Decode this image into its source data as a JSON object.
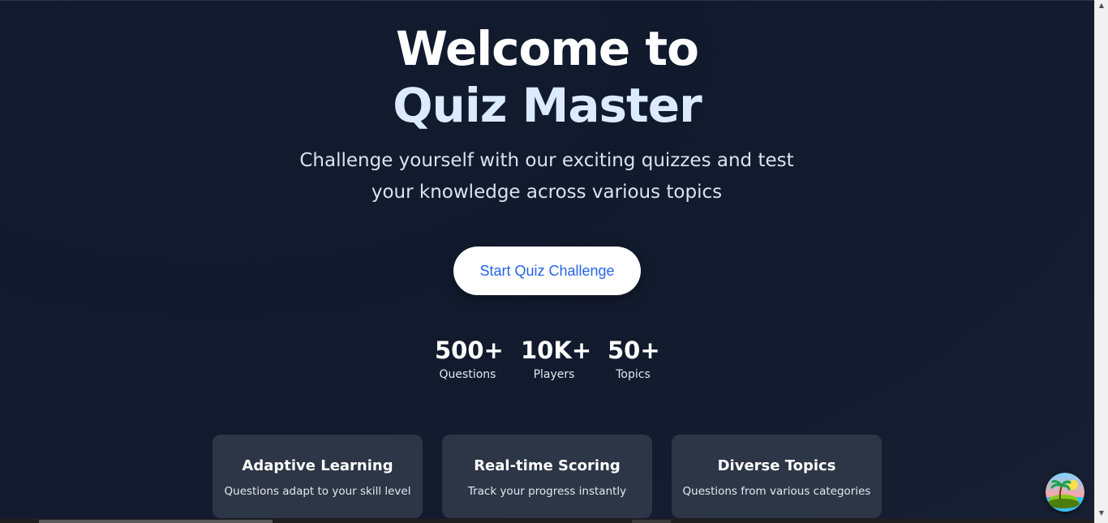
{
  "hero": {
    "title_line1": "Welcome to",
    "title_line2": "Quiz Master",
    "subtitle": "Challenge yourself with our exciting quizzes and test your knowledge across various topics",
    "cta_label": "Start Quiz Challenge"
  },
  "stats": [
    {
      "value": "500+",
      "label": "Questions"
    },
    {
      "value": "10K+",
      "label": "Players"
    },
    {
      "value": "50+",
      "label": "Topics"
    }
  ],
  "features": [
    {
      "title": "Adaptive Learning",
      "description": "Questions adapt to your skill level"
    },
    {
      "title": "Real-time Scoring",
      "description": "Track your progress instantly"
    },
    {
      "title": "Diverse Topics",
      "description": "Questions from various categories"
    }
  ],
  "floating_widget": {
    "icon": "island-palm-icon"
  },
  "colors": {
    "background": "#111a2d",
    "title_accent": "#dbeafe",
    "button_text": "#2563eb",
    "card_background": "#2d3646"
  }
}
